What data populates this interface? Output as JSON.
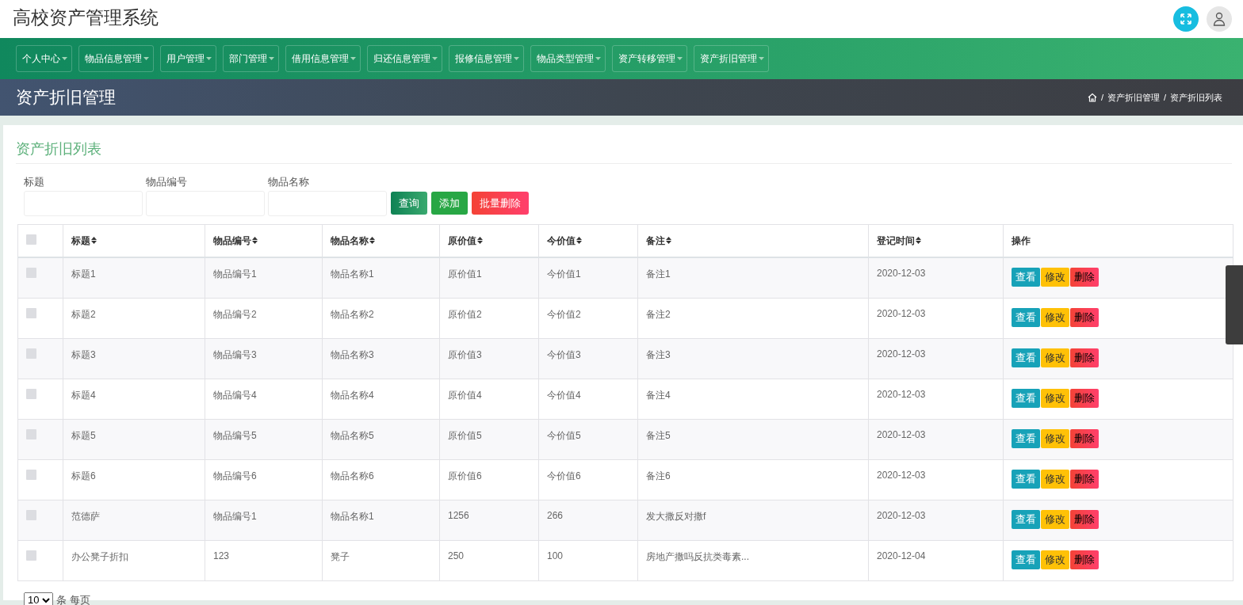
{
  "app_title": "高校资产管理系统",
  "nav": [
    {
      "label": "个人中心"
    },
    {
      "label": "物品信息管理"
    },
    {
      "label": "用户管理"
    },
    {
      "label": "部门管理"
    },
    {
      "label": "借用信息管理"
    },
    {
      "label": "归还信息管理"
    },
    {
      "label": "报修信息管理"
    },
    {
      "label": "物品类型管理"
    },
    {
      "label": "资产转移管理"
    },
    {
      "label": "资产折旧管理"
    }
  ],
  "page_title": "资产折旧管理",
  "breadcrumb": [
    {
      "separator": "/",
      "label": "资产折旧管理"
    },
    {
      "separator": "/",
      "label": "资产折旧列表"
    }
  ],
  "list_title": "资产折旧列表",
  "filters": [
    {
      "label": "标题"
    },
    {
      "label": "物品编号"
    },
    {
      "label": "物品名称"
    }
  ],
  "actions": [
    {
      "label": "查询",
      "kind": "search"
    },
    {
      "label": "添加",
      "kind": "add"
    },
    {
      "label": "批量删除",
      "kind": "delete"
    }
  ],
  "table": {
    "select_all_checked": false,
    "columns": [
      {
        "label": "标题",
        "sortable": true
      },
      {
        "label": "物品编号",
        "sortable": true
      },
      {
        "label": "物品名称",
        "sortable": true
      },
      {
        "label": "原价值",
        "sortable": true
      },
      {
        "label": "今价值",
        "sortable": true
      },
      {
        "label": "备注",
        "sortable": true
      },
      {
        "label": "登记时间",
        "sortable": true
      },
      {
        "label": "操作",
        "sortable": false
      }
    ],
    "rows": [
      {
        "checked": false,
        "cells": [
          "标题1",
          "物品编号1",
          "物品名称1",
          "原价值1",
          "今价值1",
          "备注1",
          "2020-12-03"
        ],
        "actions": [
          {
            "label": "查看",
            "kind": "view"
          },
          {
            "label": "修改",
            "kind": "edit"
          },
          {
            "label": "删除",
            "kind": "delete"
          }
        ]
      },
      {
        "checked": false,
        "cells": [
          "标题2",
          "物品编号2",
          "物品名称2",
          "原价值2",
          "今价值2",
          "备注2",
          "2020-12-03"
        ],
        "actions": [
          {
            "label": "查看",
            "kind": "view"
          },
          {
            "label": "修改",
            "kind": "edit"
          },
          {
            "label": "删除",
            "kind": "delete"
          }
        ]
      },
      {
        "checked": false,
        "cells": [
          "标题3",
          "物品编号3",
          "物品名称3",
          "原价值3",
          "今价值3",
          "备注3",
          "2020-12-03"
        ],
        "actions": [
          {
            "label": "查看",
            "kind": "view"
          },
          {
            "label": "修改",
            "kind": "edit"
          },
          {
            "label": "删除",
            "kind": "delete"
          }
        ]
      },
      {
        "checked": false,
        "cells": [
          "标题4",
          "物品编号4",
          "物品名称4",
          "原价值4",
          "今价值4",
          "备注4",
          "2020-12-03"
        ],
        "actions": [
          {
            "label": "查看",
            "kind": "view"
          },
          {
            "label": "修改",
            "kind": "edit"
          },
          {
            "label": "删除",
            "kind": "delete"
          }
        ]
      },
      {
        "checked": false,
        "cells": [
          "标题5",
          "物品编号5",
          "物品名称5",
          "原价值5",
          "今价值5",
          "备注5",
          "2020-12-03"
        ],
        "actions": [
          {
            "label": "查看",
            "kind": "view"
          },
          {
            "label": "修改",
            "kind": "edit"
          },
          {
            "label": "删除",
            "kind": "delete"
          }
        ]
      },
      {
        "checked": false,
        "cells": [
          "标题6",
          "物品编号6",
          "物品名称6",
          "原价值6",
          "今价值6",
          "备注6",
          "2020-12-03"
        ],
        "actions": [
          {
            "label": "查看",
            "kind": "view"
          },
          {
            "label": "修改",
            "kind": "edit"
          },
          {
            "label": "删除",
            "kind": "delete"
          }
        ]
      },
      {
        "checked": false,
        "cells": [
          "范德萨",
          "物品编号1",
          "物品名称1",
          "1256",
          "266",
          "发大撒反对撒f",
          "2020-12-03"
        ],
        "actions": [
          {
            "label": "查看",
            "kind": "view"
          },
          {
            "label": "修改",
            "kind": "edit"
          },
          {
            "label": "删除",
            "kind": "delete"
          }
        ]
      },
      {
        "checked": false,
        "cells": [
          "办公凳子折扣",
          "123",
          "凳子",
          "250",
          "100",
          "房地产撒吗反抗类毒素...",
          "2020-12-04"
        ],
        "actions": [
          {
            "label": "查看",
            "kind": "view"
          },
          {
            "label": "修改",
            "kind": "edit"
          },
          {
            "label": "删除",
            "kind": "delete"
          }
        ]
      }
    ]
  },
  "pagination": {
    "page_size": "10",
    "per_page_label": "条 每页"
  }
}
